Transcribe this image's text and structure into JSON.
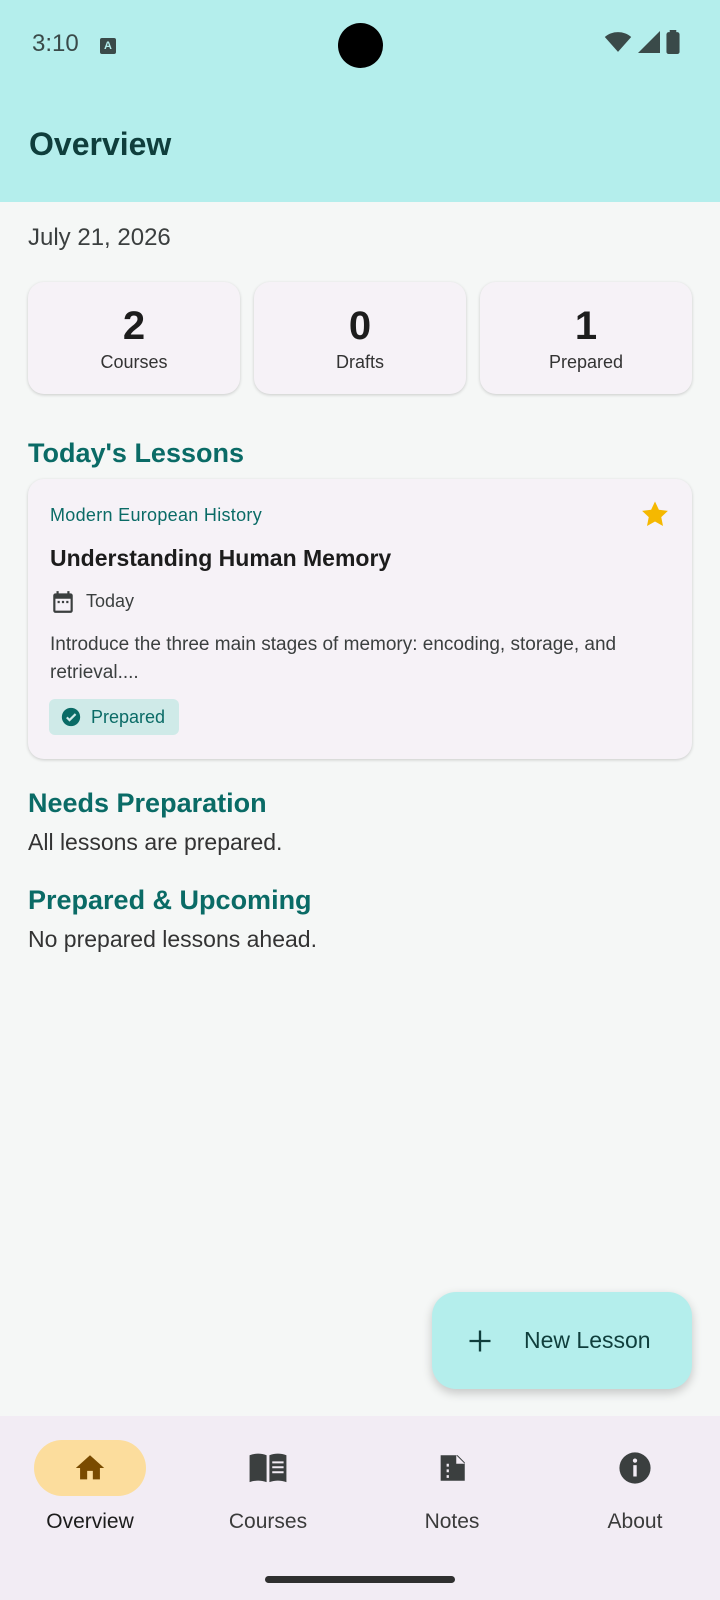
{
  "status_bar": {
    "time": "3:10",
    "a_label": "A"
  },
  "header": {
    "title": "Overview"
  },
  "date": "July 21, 2026",
  "stats": [
    {
      "value": "2",
      "label": "Courses"
    },
    {
      "value": "0",
      "label": "Drafts"
    },
    {
      "value": "1",
      "label": "Prepared"
    }
  ],
  "todays_lessons": {
    "title": "Today's Lessons",
    "lesson": {
      "course": "Modern European History",
      "title": "Understanding Human Memory",
      "date": "Today",
      "description": "Introduce the three main stages of memory: encoding, storage, and retrieval....",
      "status": "Prepared"
    }
  },
  "needs_preparation": {
    "title": "Needs Preparation",
    "text": "All lessons are prepared."
  },
  "prepared_upcoming": {
    "title": "Prepared & Upcoming",
    "text": "No prepared lessons ahead."
  },
  "fab": {
    "label": "New Lesson",
    "icon": "plus-icon"
  },
  "bottom_nav": [
    {
      "label": "Overview",
      "icon": "home-icon",
      "active": true
    },
    {
      "label": "Courses",
      "icon": "book-icon",
      "active": false
    },
    {
      "label": "Notes",
      "icon": "note-icon",
      "active": false
    },
    {
      "label": "About",
      "icon": "info-icon",
      "active": false
    }
  ],
  "colors": {
    "header_bg": "#b4eeec",
    "accent_teal": "#0a6b66",
    "star": "#f5b800",
    "active_nav": "#fcdd9d"
  }
}
